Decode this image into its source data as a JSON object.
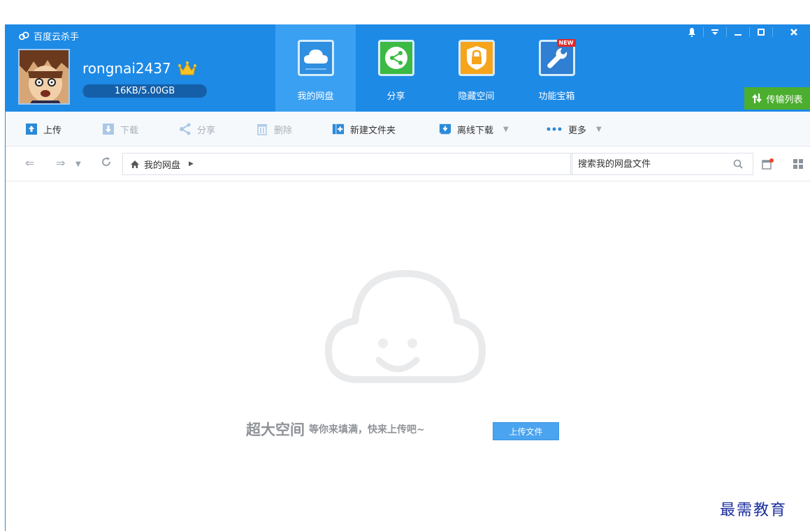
{
  "app": {
    "title": "百度云杀手"
  },
  "user": {
    "name": "rongnai2437",
    "quota_text": "16KB/5.00GB",
    "quota_used_fraction": 0.0
  },
  "tabs": [
    {
      "label": "我的网盘",
      "icon": "cloud-drive-icon",
      "active": true
    },
    {
      "label": "分享",
      "icon": "share-icon",
      "active": false
    },
    {
      "label": "隐藏空间",
      "icon": "lock-icon",
      "active": false
    },
    {
      "label": "功能宝箱",
      "icon": "toolbox-icon",
      "active": false,
      "badge": "NEW"
    }
  ],
  "transfer": {
    "label": "传输列表"
  },
  "toolbar": {
    "upload": "上传",
    "download": "下载",
    "share": "分享",
    "delete": "删除",
    "new_folder": "新建文件夹",
    "offline_download": "离线下载",
    "more": "更多"
  },
  "address": {
    "path": "我的网盘",
    "search_placeholder": "搜索我的网盘文件"
  },
  "empty": {
    "headline": "超大空间",
    "subtitle": "等你来填满，快来上传吧~",
    "button": "上传文件"
  },
  "watermark": "最需教育",
  "colors": {
    "header_bg": "#1d8ae6",
    "active_tab": "#3aa0f2",
    "transfer_green": "#4cae2f",
    "accent_blue": "#4aa4ef"
  }
}
